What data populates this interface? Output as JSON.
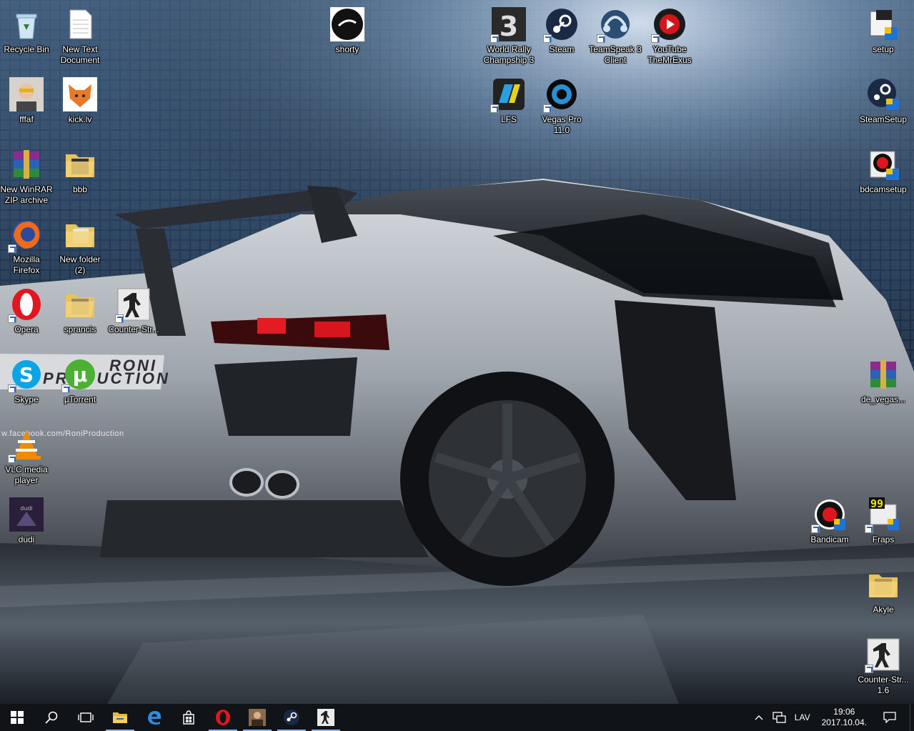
{
  "desktop": {
    "icons": [
      {
        "label": "Recycle Bin",
        "icon": "recycle-bin-icon",
        "shortcut": false
      },
      {
        "label": "New Text\nDocument",
        "icon": "text-document-icon",
        "shortcut": false
      },
      {
        "label": "shorty",
        "icon": "shorty-image-icon",
        "shortcut": false
      },
      {
        "label": "World Rally\nChampship 3",
        "icon": "world-rally-championship-icon",
        "shortcut": true
      },
      {
        "label": "Steam",
        "icon": "steam-icon",
        "shortcut": true
      },
      {
        "label": "TeamSpeak 3\nClient",
        "icon": "teamspeak-icon",
        "shortcut": true
      },
      {
        "label": "YouTube\nTheMrExus",
        "icon": "youtube-channel-icon",
        "shortcut": true
      },
      {
        "label": "setup",
        "icon": "setup-installer-icon",
        "shortcut": false
      },
      {
        "label": "fffaf",
        "icon": "photo-thumbnail-icon",
        "shortcut": false
      },
      {
        "label": "kick.lv",
        "icon": "kick-lv-icon",
        "shortcut": false
      },
      {
        "label": "LFS",
        "icon": "lfs-icon",
        "shortcut": true
      },
      {
        "label": "Vegas Pro\n11.0",
        "icon": "vegas-pro-icon",
        "shortcut": true
      },
      {
        "label": "SteamSetup",
        "icon": "steam-setup-icon",
        "shortcut": false
      },
      {
        "label": "New WinRAR\nZIP archive",
        "icon": "winrar-archive-icon",
        "shortcut": false
      },
      {
        "label": "bbb",
        "icon": "folder-icon",
        "shortcut": false
      },
      {
        "label": "bdcamsetup",
        "icon": "bandicam-setup-icon",
        "shortcut": false
      },
      {
        "label": "Mozilla\nFirefox",
        "icon": "firefox-icon",
        "shortcut": true
      },
      {
        "label": "New folder\n(2)",
        "icon": "folder-icon",
        "shortcut": false
      },
      {
        "label": "Opera",
        "icon": "opera-icon",
        "shortcut": true
      },
      {
        "label": "sprancis",
        "icon": "folder-icon",
        "shortcut": false
      },
      {
        "label": "Counter-Str...",
        "icon": "counter-strike-icon",
        "shortcut": true
      },
      {
        "label": "Skype",
        "icon": "skype-icon",
        "shortcut": true
      },
      {
        "label": "µTorrent",
        "icon": "utorrent-icon",
        "shortcut": true
      },
      {
        "label": "de_vegas...",
        "icon": "winrar-archive-icon",
        "shortcut": false
      },
      {
        "label": "VLC media\nplayer",
        "icon": "vlc-icon",
        "shortcut": true
      },
      {
        "label": "dudi",
        "icon": "photo-thumbnail-icon",
        "shortcut": false
      },
      {
        "label": "Bandicam",
        "icon": "bandicam-icon",
        "shortcut": true
      },
      {
        "label": "Fraps",
        "icon": "fraps-icon",
        "shortcut": true
      },
      {
        "label": "Akyle",
        "icon": "folder-icon",
        "shortcut": false
      },
      {
        "label": "Counter-Str...\n1.6",
        "icon": "counter-strike-icon",
        "shortcut": true
      }
    ],
    "wallpaper": {
      "plate_text": "RONI\nPRODUCTION",
      "url_text": "w.facebook.com/RoniProduction"
    }
  },
  "taskbar": {
    "pinned": [
      {
        "name": "start-button",
        "icon": "windows-logo-icon"
      },
      {
        "name": "search-button",
        "icon": "search-icon"
      },
      {
        "name": "task-view-button",
        "icon": "task-view-icon"
      },
      {
        "name": "file-explorer-button",
        "icon": "file-explorer-icon"
      },
      {
        "name": "edge-button",
        "icon": "edge-icon"
      },
      {
        "name": "store-button",
        "icon": "store-icon"
      },
      {
        "name": "opera-taskbar-button",
        "icon": "opera-icon"
      },
      {
        "name": "photo-taskbar-button",
        "icon": "photo-thumbnail-icon"
      },
      {
        "name": "steam-taskbar-button",
        "icon": "steam-icon"
      },
      {
        "name": "counter-strike-taskbar-button",
        "icon": "counter-strike-icon"
      }
    ],
    "tray": {
      "language": "LAV",
      "time": "19:06",
      "date": "2017.10.04."
    }
  },
  "colors": {
    "taskbar_bg": "#101418",
    "accent": "#8ab6e6"
  }
}
